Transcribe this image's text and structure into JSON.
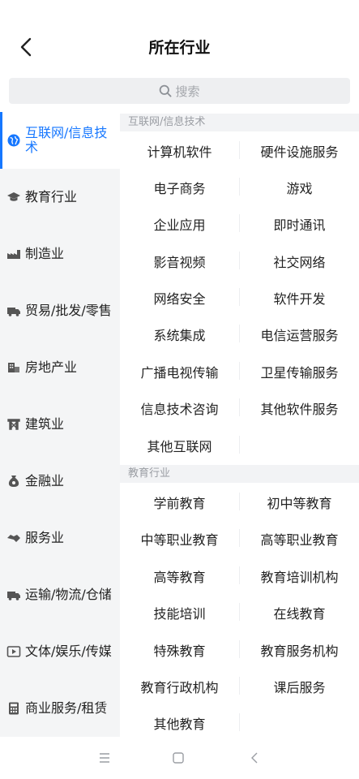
{
  "header": {
    "title": "所在行业"
  },
  "search": {
    "placeholder": "搜索"
  },
  "sidebar": {
    "items": [
      {
        "label": "互联网/信息技术",
        "active": true
      },
      {
        "label": "教育行业"
      },
      {
        "label": "制造业"
      },
      {
        "label": "贸易/批发/零售"
      },
      {
        "label": "房地产业"
      },
      {
        "label": "建筑业"
      },
      {
        "label": "金融业"
      },
      {
        "label": "服务业"
      },
      {
        "label": "运输/物流/仓储"
      },
      {
        "label": "文体/娱乐/传媒"
      },
      {
        "label": "商业服务/租赁"
      }
    ]
  },
  "content": {
    "sections": [
      {
        "title": "互联网/信息技术",
        "items": [
          "计算机软件",
          "硬件设施服务",
          "电子商务",
          "游戏",
          "企业应用",
          "即时通讯",
          "影音视频",
          "社交网络",
          "网络安全",
          "软件开发",
          "系统集成",
          "电信运营服务",
          "广播电视传输",
          "卫星传输服务",
          "信息技术咨询",
          "其他软件服务",
          "其他互联网"
        ]
      },
      {
        "title": "教育行业",
        "items": [
          "学前教育",
          "初中等教育",
          "中等职业教育",
          "高等职业教育",
          "高等教育",
          "教育培训机构",
          "技能培训",
          "在线教育",
          "特殊教育",
          "教育服务机构",
          "教育行政机构",
          "课后服务",
          "其他教育"
        ]
      }
    ]
  },
  "colors": {
    "accent": "#1677ff",
    "sidebar_bg": "#f4f5f6",
    "section_bg": "#f2f3f5"
  }
}
